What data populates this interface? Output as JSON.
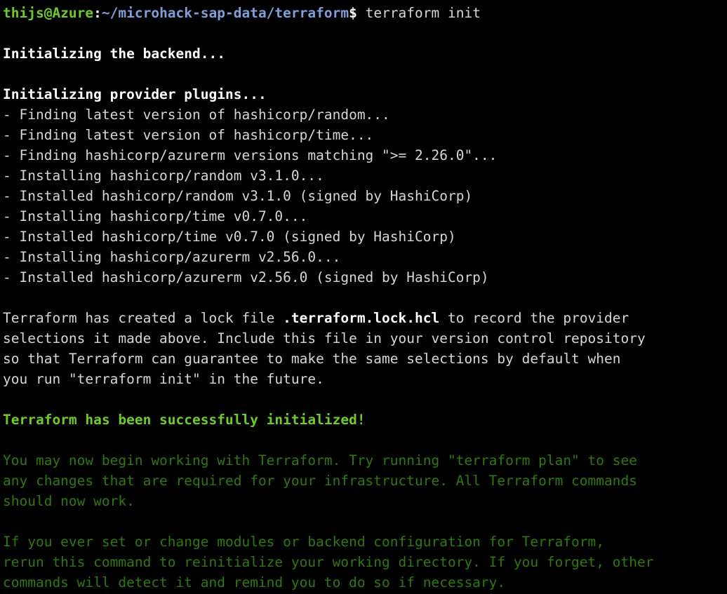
{
  "terminal": {
    "title": "terraform init",
    "background_color": "#000000",
    "foreground_color": "#d6d6d6",
    "colors": {
      "prompt_user_host": "#6ccc29",
      "prompt_path": "#7f9fdc",
      "bright_green": "#6ccc29",
      "dim_green": "#2d7a0b",
      "white": "#d6d6d6",
      "bold_white": "#ffffff"
    },
    "clipped_top_line": "thijs@Azure:~/microhack-sap-data/terraform$ terraform init",
    "prompt": {
      "user_host": "thijs@Azure",
      "separator": ":",
      "path": "~/microhack-sap-data/terraform",
      "symbol": "$",
      "command": " terraform init"
    },
    "lines": [
      {
        "id": "line-blank-1",
        "style": "blank",
        "text": " "
      },
      {
        "id": "line-init-backend",
        "style": "bold",
        "text": "Initializing the backend..."
      },
      {
        "id": "line-blank-2",
        "style": "blank",
        "text": " "
      },
      {
        "id": "line-init-providers",
        "style": "bold",
        "text": "Initializing provider plugins..."
      },
      {
        "id": "line-find-random",
        "style": "white",
        "text": "- Finding latest version of hashicorp/random..."
      },
      {
        "id": "line-find-time",
        "style": "white",
        "text": "- Finding latest version of hashicorp/time..."
      },
      {
        "id": "line-find-azurerm",
        "style": "white",
        "text": "- Finding hashicorp/azurerm versions matching \">= 2.26.0\"..."
      },
      {
        "id": "line-installing-random",
        "style": "white",
        "text": "- Installing hashicorp/random v3.1.0..."
      },
      {
        "id": "line-installed-random",
        "style": "white",
        "text": "- Installed hashicorp/random v3.1.0 (signed by HashiCorp)"
      },
      {
        "id": "line-installing-time",
        "style": "white",
        "text": "- Installing hashicorp/time v0.7.0..."
      },
      {
        "id": "line-installed-time",
        "style": "white",
        "text": "- Installed hashicorp/time v0.7.0 (signed by HashiCorp)"
      },
      {
        "id": "line-installing-azurerm",
        "style": "white",
        "text": "- Installing hashicorp/azurerm v2.56.0..."
      },
      {
        "id": "line-installed-azurerm",
        "style": "white",
        "text": "- Installed hashicorp/azurerm v2.56.0 (signed by HashiCorp)"
      },
      {
        "id": "line-blank-3",
        "style": "blank",
        "text": " "
      }
    ],
    "lockfile_paragraph": {
      "line1_pre": "Terraform has created a lock file ",
      "line1_bold": ".terraform.lock.hcl",
      "line1_post": " to record the provider",
      "line2": "selections it made above. Include this file in your version control repository",
      "line3": "so that Terraform can guarantee to make the same selections by default when",
      "line4": "you run \"terraform init\" in the future."
    },
    "success_line": "Terraform has been successfully initialized!",
    "next_steps_paragraph": [
      "You may now begin working with Terraform. Try running \"terraform plan\" to see",
      "any changes that are required for your infrastructure. All Terraform commands",
      "should now work."
    ],
    "reinit_paragraph": [
      "If you ever set or change modules or backend configuration for Terraform,",
      "rerun this command to reinitialize your working directory. If you forget, other",
      "commands will detect it and remind you to do so if necessary."
    ]
  }
}
